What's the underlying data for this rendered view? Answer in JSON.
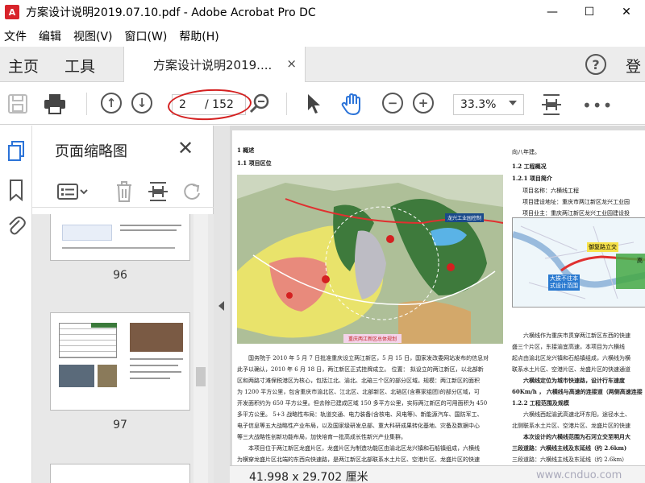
{
  "window": {
    "title": "方案设计说明2019.07.10.pdf - Adobe Acrobat Pro DC",
    "minimize": "—",
    "maximize": "☐",
    "close": "✕"
  },
  "menu": [
    "文件",
    "编辑",
    "视图(V)",
    "窗口(W)",
    "帮助(H)"
  ],
  "tabs": {
    "home": "主页",
    "tools": "工具",
    "doc": "方案设计说明2019....",
    "doc_close": "×",
    "help": "?",
    "signin": "登"
  },
  "toolbar": {
    "page_current": "2",
    "page_total": "/ 152",
    "zoom": "33.3%"
  },
  "panel": {
    "title": "页面缩略图",
    "close": "✕",
    "thumbnails": [
      {
        "num": "96"
      },
      {
        "num": "97"
      }
    ]
  },
  "doc": {
    "heading1": "1 概述",
    "heading11": "1.1 项目区位",
    "map_label_top": "龙兴工业园控制",
    "map_caption": "重庆两江新区总体规划",
    "right_intro": "向八年建。",
    "h12": "1.2 工程概况",
    "h121": "1.2.1 项目简介",
    "info1": "项目名称：六横线工程",
    "info2": "项目建设地址：重庆市两江新区龙兴工业园",
    "info3": "项目业主：重庆两江新区龙兴工业园建设投",
    "map2_label1": "御复路立交",
    "map2_label2": "大挨不往本\n式设计范围",
    "map2_label3": "高",
    "p1": "国务院于 2010 年 5 月 7 日批准重庆设立两江新区，5 月 15 日，国家发改委网站发布的信息对",
    "p2": "此予以确认，2010 年 6 月 18 日，两江新区正式挂牌成立。  位置：   拟设立的两江新区，以北部新",
    "p3": "区和两路寸滩保税港区为核心，包括江北、渝北、北碚三个区的部分区域。规模：两江新区的面积",
    "p4": "为 1200 平方公里，包含重庆市渝北区、江北区、北部新区、北碚区(含蔡家组团)的部分区域，可",
    "p5": "开发面积约为 650 平方公里。但去除已建成区域 150 多平方公里，实际两江新区的可用面积为 450",
    "p6": "多平方公里。  5+3 战略性布局：轨道交通、电力装备(含核电、风电等)、新能源汽车、国防军工、",
    "p7": "电子信息等五大战略性产业布局，以及国家级研发总部、重大科研成果转化基地、灾备及数据中心",
    "p8": "等三大战略性创新功能布局，加快培育一批高成长性新兴产业集群。",
    "p9": "本项目位于两江新区龙盛片区，龙盛片区为制造功能区由渝北区龙兴镇和石船镇组成，六横线",
    "p10": "为横穿龙盛片区北端的东西向快速路，是两江新区北部联系水土片区、空港片区、龙盛片区的快速",
    "r1": "六横线作为重庆市贯穿两江新区东西的快速",
    "r2": "盛三个片区，东接渝宜高速，本项目为六横线",
    "r3": "起点由渝北区龙兴镇和石船镇组成，六横线为横",
    "r4": "联系水土片区、空港片区、龙盛片区的快速通道",
    "r5": "六横线定位为城市快速路，设计行车速度",
    "r6": "60Km/h ，  六横线与高速的连接道（两侧高速连接",
    "r7": "1.2.2 工程范围及规模",
    "r8": "六横线西起渝武高速北环东阳，途径水土、",
    "r9": "北侧联系水土片区、空港片区、龙盛片区的快速",
    "r10": "本次设计的六横线范围为石河立交至明月大",
    "r11": "三段道路：六横线主线及东延线（约 2.6km)",
    "r12": "三段道路：六横线主线及东延线（约 2.6km）"
  },
  "status": {
    "dimensions": "41.998 x 29.702 厘米",
    "watermark": "www.cnduo.com"
  }
}
